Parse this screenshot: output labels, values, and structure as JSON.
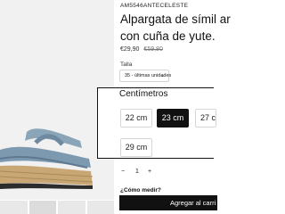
{
  "product": {
    "sku": "AM5546ANTECELESTE",
    "title_line1": "Alpargata de símil ar",
    "title_line2": "con cuña de yute.",
    "price": "€29,90",
    "old_price": "€59,80"
  },
  "size": {
    "label": "Talla",
    "selected_value": "35 - últimas unidades"
  },
  "measure_panel": {
    "title": "Centímetros",
    "options": [
      "22 cm",
      "23 cm",
      "27 c",
      "29 cm"
    ],
    "selected": "23 cm"
  },
  "quantity": {
    "minus": "−",
    "value": "1",
    "plus": "+"
  },
  "links": {
    "how_to_measure": "¿Cómo medir?"
  },
  "actions": {
    "add_to_cart": "Agregar al carri"
  },
  "icons": {
    "select_chevron": "chevron-down-icon"
  }
}
